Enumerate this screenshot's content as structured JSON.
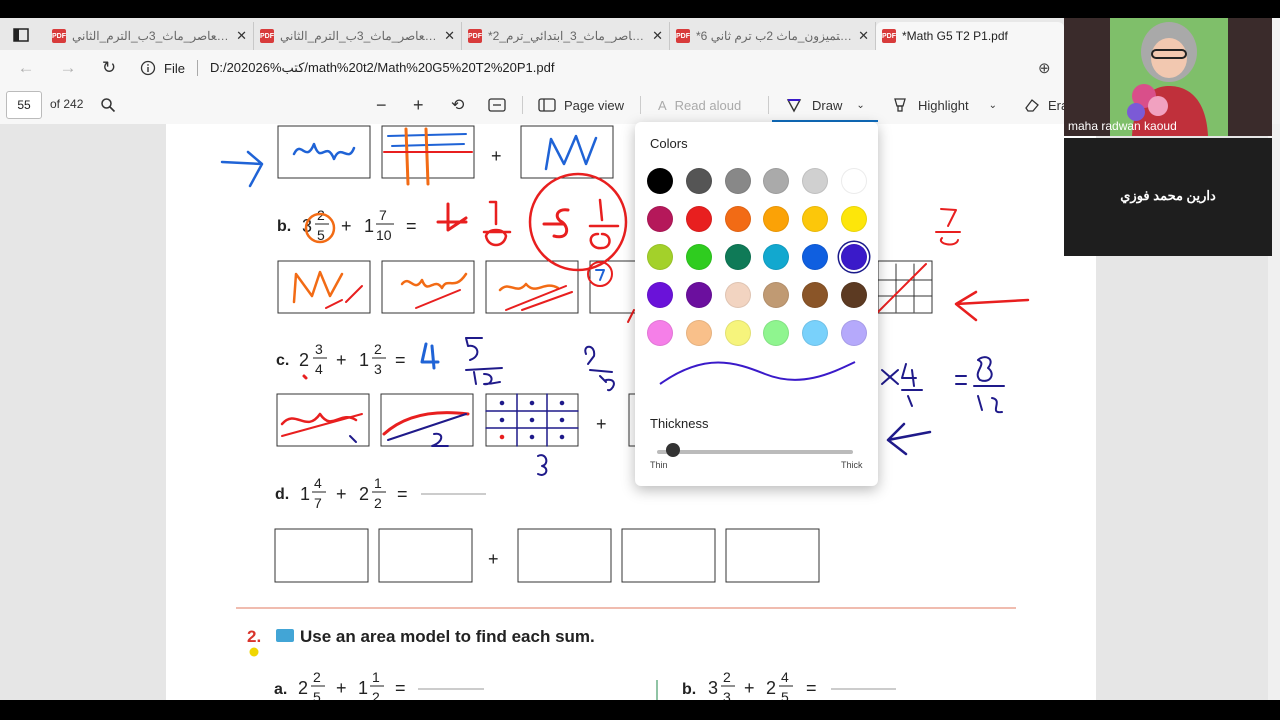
{
  "browser": {
    "tabs": [
      {
        "label": "المعاصر_ماث_3ب_الترم_الثاني",
        "active": false
      },
      {
        "label": "المعاصر_ماث_3ب_الترم_الثاني",
        "active": false
      },
      {
        "label": "*المعاصر_ماث_3_ابتدائي_ترم_2",
        "active": false
      },
      {
        "label": "*المتميزون_ماث 2ب ترم ثاني 6",
        "active": false
      },
      {
        "label": "*Math G5 T2 P1.pdf",
        "active": true
      }
    ],
    "address": {
      "scheme_label": "File",
      "url": "D:/202026%كتب/math%20t2/Math%20G5%20T2%20P1.pdf"
    }
  },
  "pdf_toolbar": {
    "page_number": "55",
    "page_total": "of 242",
    "page_view_label": "Page view",
    "read_aloud_label": "Read aloud",
    "draw_label": "Draw",
    "highlight_label": "Highlight",
    "erase_label": "Era"
  },
  "document": {
    "problems": [
      {
        "letter": "b.",
        "whole1": "3",
        "num1": "2",
        "den1": "5",
        "op": "+",
        "whole2": "1",
        "num2": "7",
        "den2": "10",
        "eq": "="
      },
      {
        "letter": "c.",
        "whole1": "2",
        "num1": "3",
        "den1": "4",
        "op": "+",
        "whole2": "1",
        "num2": "2",
        "den2": "3",
        "eq": "="
      },
      {
        "letter": "d.",
        "whole1": "1",
        "num1": "4",
        "den1": "7",
        "op": "+",
        "whole2": "2",
        "num2": "1",
        "den2": "2",
        "eq": "="
      }
    ],
    "plus_sign": "+",
    "section2": {
      "number": "2.",
      "instruction": "Use an area model to find each sum.",
      "a": {
        "letter": "a.",
        "whole1": "2",
        "num1": "2",
        "den1": "5",
        "op": "+",
        "whole2": "1",
        "num2": "1",
        "den2": "2",
        "eq": "="
      },
      "b": {
        "letter": "b.",
        "whole1": "3",
        "num1": "2",
        "den1": "3",
        "op": "+",
        "whole2": "2",
        "num2": "4",
        "den2": "5",
        "eq": "="
      }
    }
  },
  "color_picker": {
    "title": "Colors",
    "swatches": [
      [
        "#000000",
        "#555555",
        "#888888",
        "#aaaaaa",
        "#d0d0d0",
        "#ffffff"
      ],
      [
        "#b5185a",
        "#e81f1f",
        "#f26b15",
        "#fba206",
        "#fcc70a",
        "#fde60a"
      ],
      [
        "#a3d12a",
        "#2fcc1f",
        "#0f7a57",
        "#12a8cf",
        "#0f5fe0",
        "#3a1ac9"
      ],
      [
        "#6a12d9",
        "#6b0f9e",
        "#f2d4c1",
        "#c09a73",
        "#8a5528",
        "#5c3a22"
      ],
      [
        "#f57fe8",
        "#f9c08a",
        "#f6f47c",
        "#8ff58f",
        "#79d1fb",
        "#b5a9fb"
      ]
    ],
    "selected_color": "#3a1ac9",
    "thickness_title": "Thickness",
    "thin_label": "Thin",
    "thick_label": "Thick",
    "thickness_level": 0.03
  },
  "participants": [
    {
      "name": "maha radwan kaoud"
    },
    {
      "name": "دارين محمد فوزي"
    }
  ]
}
